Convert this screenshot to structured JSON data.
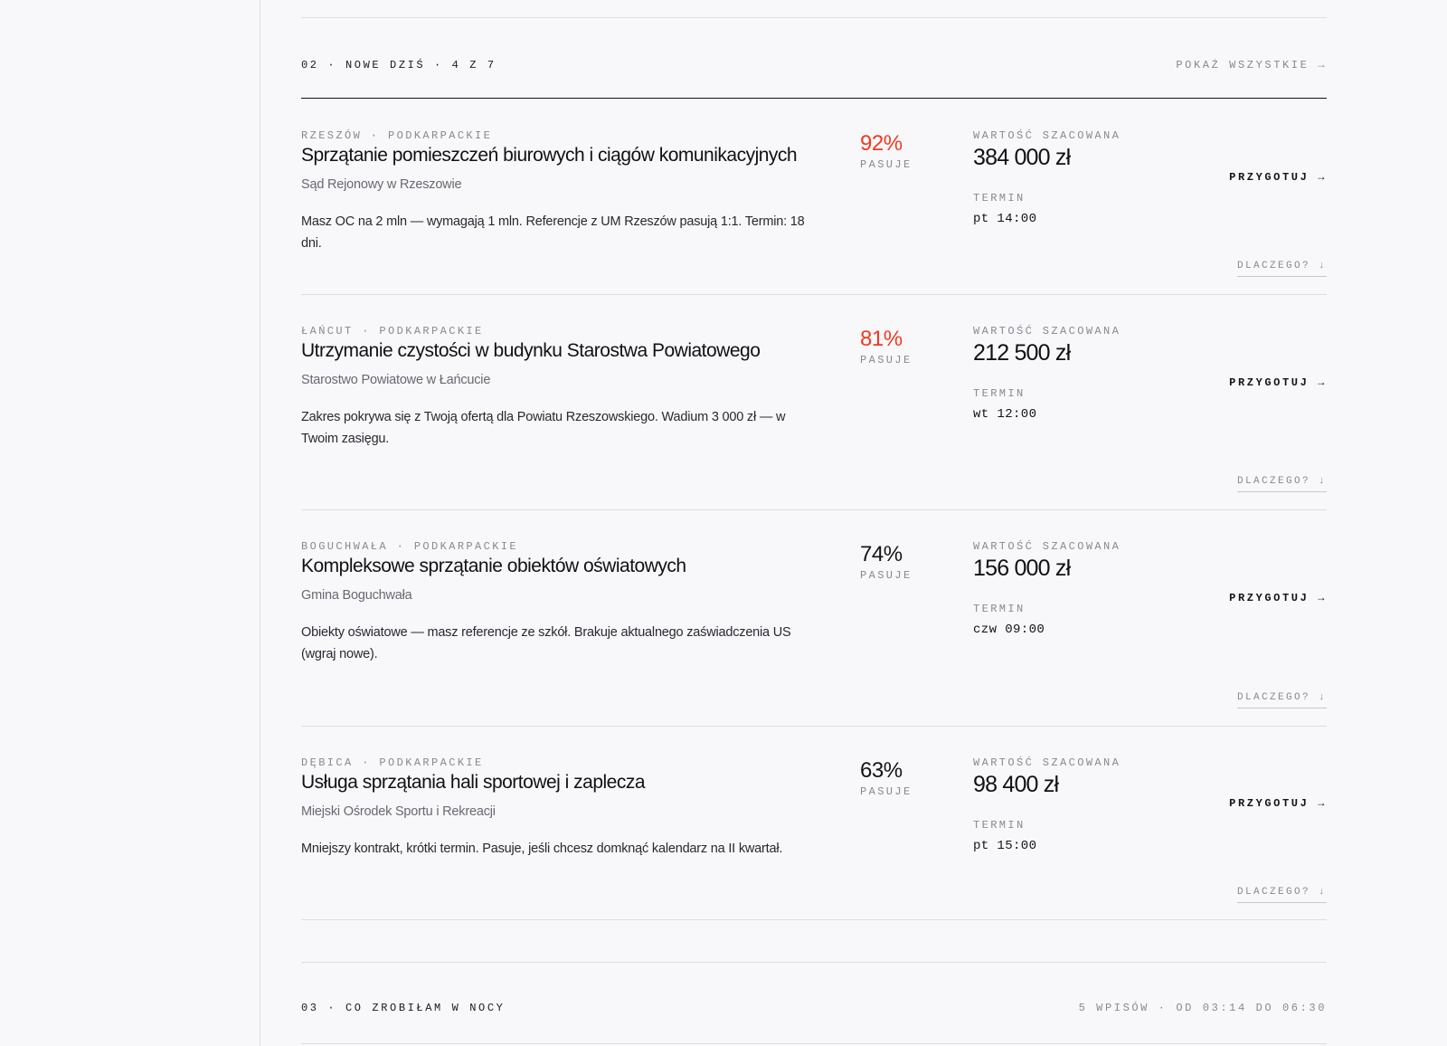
{
  "section2": {
    "label": "02 · NOWE DZIŚ · 4 Z 7",
    "link": "POKAŻ WSZYSTKIE →"
  },
  "tenders": [
    {
      "kicker": "RZESZÓW · PODKARPACKIE",
      "title": "Sprzątanie pomieszczeń biurowych i ciągów komunikacyjnych",
      "buyer": "Sąd Rejonowy w Rzeszowie",
      "note": "Masz OC na 2 mln — wymagają 1 mln. Referencje z UM Rzeszów pasują 1:1. Termin: 18 dni.",
      "score": "92%",
      "score_label": "PASUJE",
      "value_label": "WARTOŚĆ SZACOWANA",
      "value": "384 000 zł",
      "term_label": "TERMIN",
      "term": "pt 14:00",
      "prepare": "PRZYGOTUJ →",
      "why": "DLACZEGO? ↓"
    },
    {
      "kicker": "ŁAŃCUT · PODKARPACKIE",
      "title": "Utrzymanie czystości w budynku Starostwa Powiatowego",
      "buyer": "Starostwo Powiatowe w Łańcucie",
      "note": "Zakres pokrywa się z Twoją ofertą dla Powiatu Rzeszowskiego. Wadium 3 000 zł — w Twoim zasięgu.",
      "score": "81%",
      "score_label": "PASUJE",
      "value_label": "WARTOŚĆ SZACOWANA",
      "value": "212 500 zł",
      "term_label": "TERMIN",
      "term": "wt 12:00",
      "prepare": "PRZYGOTUJ →",
      "why": "DLACZEGO? ↓"
    },
    {
      "kicker": "BOGUCHWAŁA · PODKARPACKIE",
      "title": "Kompleksowe sprzątanie obiektów oświatowych",
      "buyer": "Gmina Boguchwała",
      "note": "Obiekty oświatowe — masz referencje ze szkół. Brakuje aktualnego zaświadczenia US (wgraj nowe).",
      "score": "74%",
      "score_label": "PASUJE",
      "value_label": "WARTOŚĆ SZACOWANA",
      "value": "156 000 zł",
      "term_label": "TERMIN",
      "term": "czw 09:00",
      "prepare": "PRZYGOTUJ →",
      "why": "DLACZEGO? ↓"
    },
    {
      "kicker": "DĘBICA · PODKARPACKIE",
      "title": "Usługa sprzątania hali sportowej i zaplecza",
      "buyer": "Miejski Ośrodek Sportu i Rekreacji",
      "note": "Mniejszy kontrakt, krótki termin. Pasuje, jeśli chcesz domknąć kalendarz na II kwartał.",
      "score": "63%",
      "score_label": "PASUJE",
      "value_label": "WARTOŚĆ SZACOWANA",
      "value": "98 400 zł",
      "term_label": "TERMIN",
      "term": "pt 15:00",
      "prepare": "PRZYGOTUJ →",
      "why": "DLACZEGO? ↓"
    }
  ],
  "section3": {
    "label": "03 · CO ZROBIŁAM W NOCY",
    "meta": "5 WPISÓW · OD 03:14 DO 06:30"
  },
  "colors": {
    "accent_high_match": "#ef3a20",
    "text": "#141414",
    "muted": "#8a8890",
    "background": "#f8f7fa"
  }
}
